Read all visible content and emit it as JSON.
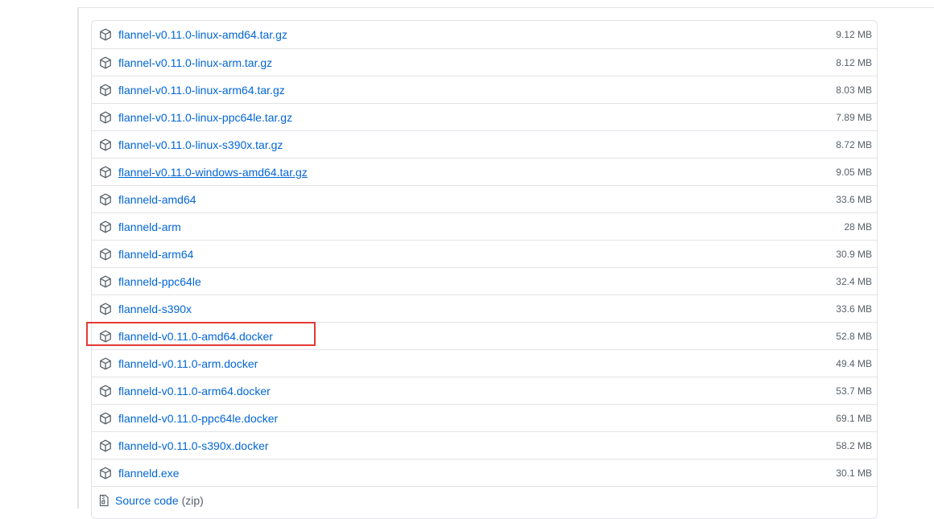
{
  "assets": [
    {
      "name": "flannel-v0.11.0-linux-amd64.tar.gz",
      "size": "9.12 MB"
    },
    {
      "name": "flannel-v0.11.0-linux-arm.tar.gz",
      "size": "8.12 MB"
    },
    {
      "name": "flannel-v0.11.0-linux-arm64.tar.gz",
      "size": "8.03 MB"
    },
    {
      "name": "flannel-v0.11.0-linux-ppc64le.tar.gz",
      "size": "7.89 MB"
    },
    {
      "name": "flannel-v0.11.0-linux-s390x.tar.gz",
      "size": "8.72 MB"
    },
    {
      "name": "flannel-v0.11.0-windows-amd64.tar.gz",
      "size": "9.05 MB",
      "hovered": true
    },
    {
      "name": "flanneld-amd64",
      "size": "33.6 MB"
    },
    {
      "name": "flanneld-arm",
      "size": "28 MB"
    },
    {
      "name": "flanneld-arm64",
      "size": "30.9 MB"
    },
    {
      "name": "flanneld-ppc64le",
      "size": "32.4 MB"
    },
    {
      "name": "flanneld-s390x",
      "size": "33.6 MB"
    },
    {
      "name": "flanneld-v0.11.0-amd64.docker",
      "size": "52.8 MB",
      "highlighted": true
    },
    {
      "name": "flanneld-v0.11.0-arm.docker",
      "size": "49.4 MB"
    },
    {
      "name": "flanneld-v0.11.0-arm64.docker",
      "size": "53.7 MB"
    },
    {
      "name": "flanneld-v0.11.0-ppc64le.docker",
      "size": "69.1 MB"
    },
    {
      "name": "flanneld-v0.11.0-s390x.docker",
      "size": "58.2 MB"
    },
    {
      "name": "flanneld.exe",
      "size": "30.1 MB"
    }
  ],
  "source": {
    "label": "Source code",
    "suffix": "(zip)"
  },
  "colors": {
    "link": "#0366d6",
    "muted": "#586069",
    "border": "#e1e4e8",
    "highlight": "#e53935"
  },
  "icons": {
    "asset": "package-icon",
    "source": "file-zip-icon"
  }
}
